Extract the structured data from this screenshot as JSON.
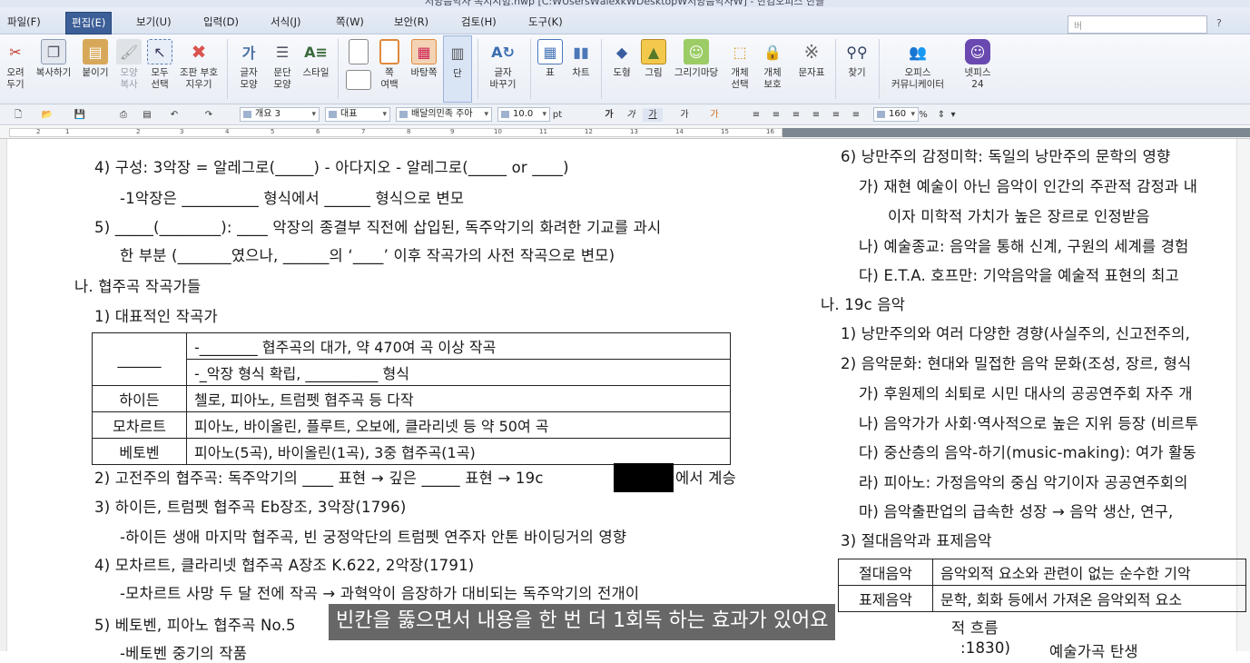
{
  "window": {
    "title": "서양음악사 복지시험.hwp [C:₩Users₩alexk₩Desktop₩서양음악사₩] - 한컴오피스 한글"
  },
  "menu": {
    "items": [
      "파일(F)",
      "편집(E)",
      "보기(U)",
      "입력(D)",
      "서식(J)",
      "쪽(W)",
      "보안(R)",
      "검토(H)",
      "도구(K)"
    ],
    "active": "편집(E)",
    "search_placeholder": "버"
  },
  "ribbon": {
    "buttons": [
      {
        "label": "오려\n두기",
        "icon": "scissors-icon",
        "color": "#c0392b"
      },
      {
        "label": "복사하기",
        "icon": "copy-icon",
        "color": "#7a8fa8"
      },
      {
        "label": "붙이기",
        "icon": "paste-icon",
        "color": "#c89a4a"
      },
      {
        "label": "모양\n복사",
        "icon": "format-painter-icon",
        "color": "#b8bec8"
      },
      {
        "label": "모두\n선택",
        "icon": "select-all-icon",
        "color": "#5b7fb8"
      },
      {
        "label": "조판 부호\n지우기",
        "icon": "clear-codes-icon",
        "color": "#d9534f"
      },
      {
        "label": "글자\n모양",
        "icon": "char-shape-icon",
        "color": "#4a6fa5"
      },
      {
        "label": "문단\n모양",
        "icon": "para-shape-icon",
        "color": "#6b7d95"
      },
      {
        "label": "스타일",
        "icon": "style-icon",
        "color": "#5a8a5a"
      },
      {
        "label": "쪽\n여백",
        "icon": "page-margin-icon",
        "color": "#9aa8bb"
      },
      {
        "label": "바탕쪽",
        "icon": "master-page-icon",
        "color": "#e08a3c"
      },
      {
        "label": "단",
        "icon": "columns-icon",
        "color": "#6b7d95"
      },
      {
        "label": "글자\n바꾸기",
        "icon": "replace-char-icon",
        "color": "#3a6fb0"
      },
      {
        "label": "표",
        "icon": "table-icon",
        "color": "#4a78b8"
      },
      {
        "label": "차트",
        "icon": "chart-icon",
        "color": "#4a78b8"
      },
      {
        "label": "도형",
        "icon": "shape-icon",
        "color": "#3a5fa0"
      },
      {
        "label": "그림",
        "icon": "picture-icon",
        "color": "#e0b040"
      },
      {
        "label": "그리기마당",
        "icon": "clipart-icon",
        "color": "#7fb84a"
      },
      {
        "label": "개체\n선택",
        "icon": "object-select-icon",
        "color": "#e0b040"
      },
      {
        "label": "개체\n보호",
        "icon": "object-lock-icon",
        "color": "#e0a030"
      },
      {
        "label": "문자표",
        "icon": "symbol-icon",
        "color": "#777"
      },
      {
        "label": "찾기",
        "icon": "binoculars-icon",
        "color": "#3a4a6a"
      },
      {
        "label": "오피스\n커뮤니케이터",
        "icon": "communicator-icon",
        "color": "#6a9ad0"
      },
      {
        "label": "넷피스\n24",
        "icon": "netffice-icon",
        "color": "#6a4ab0"
      }
    ]
  },
  "format_toolbar": {
    "style": "개요 3",
    "font_group": "대표",
    "font": "배달의민족 주아",
    "size": "10.0",
    "unit": "pt",
    "zoom": "160",
    "zoom_unit": "%"
  },
  "ruler": {
    "ticks": [
      "2",
      "1",
      "2",
      "3",
      "4",
      "5",
      "6",
      "7",
      "8",
      "9",
      "10",
      "11",
      "12",
      "13",
      "14",
      "15",
      "16"
    ]
  },
  "document": {
    "left": {
      "lines": [
        "4) 구성: 3악장 = 알레그로(_____) - 아다지오 - 알레그로(_____ or ____)",
        "-1악장은 __________ 형식에서 ______ 형식으로 변모",
        "5) _____(________): ____ 악장의 종결부 직전에 삽입된, 독주악기의 화려한 기교를 과시",
        "한 부분 (_______였으나, ______의 ‘____’ 이후 작곡가의 사전 작곡으로 변모)",
        "나. 협주곡 작곡가들",
        "1) 대표적인 작곡가"
      ],
      "table": {
        "row0_name": "______",
        "row0_line1": "-________ 협주곡의 대가, 약 470여 곡 이상 작곡",
        "row0_line2": "-_악장 형식 확립, __________ 형식",
        "rows": [
          {
            "name": "하이든",
            "desc": "첼로, 피아노, 트럼펫 협주곡 등 다작"
          },
          {
            "name": "모차르트",
            "desc": "피아노, 바이올린, 플루트, 오보에, 클라리넷 등 약 50여 곡"
          },
          {
            "name": "베토벤",
            "desc": "피아노(5곡), 바이올린(1곡), 3중 협주곡(1곡)"
          }
        ]
      },
      "lines2": [
        "2) 고전주의 협주곡: 독주악기의 ____ 표현 → 깊은 _____ 표현 → 19c",
        "에서 계승",
        "3) 하이든, 트럼펫 협주곡 Eb장조, 3악장(1796)",
        "-하이든 생애 마지막 협주곡, 빈 궁정악단의 트럼펫 연주자 안톤 바이딩거의 영향",
        "4) 모차르트, 클라리넷 협주곡 A장조 K.622, 2악장(1791)",
        "-모차르트 사망 두 달 전에 작곡 → 과혁악이 음장하가 대비되는 독주악기의 전개이",
        "5) 베토벤, 피아노 협주곡 No.5",
        "-베토벤 중기의 작품"
      ]
    },
    "right": {
      "lines": [
        "6) 낭만주의 감정미학: 독일의 낭만주의 문학의 영향",
        "가) 재현 예술이 아닌 음악이 인간의 주관적 감정과 내",
        "이자 미학적 가치가 높은 장르로 인정받음",
        "나) 예술종교: 음악을 통해 신계, 구원의 세계를 경험",
        "다) E.T.A. 호프만: 기악음악을 예술적 표현의 최고",
        "나. 19c 음악",
        "1) 낭만주의와 여러 다양한 경향(사실주의, 신고전주의,",
        "2) 음악문화: 현대와 밀접한 음악 문화(조성, 장르, 형식",
        "가) 후원제의 쇠퇴로 시민 대사의 공공연주회 자주 개",
        "나) 음악가가 사회·역사적으로 높은 지위 등장 (비르투",
        "다) 중산층의 음악-하기(music-making): 여가 활동",
        "라) 피아노: 가정음악의 중심 악기이자 공공연주회의",
        "마) 음악출판업의 급속한 성장 → 음악 생산, 연구,",
        "3) 절대음악과 표제음악"
      ],
      "table": {
        "rows": [
          {
            "name": "절대음악",
            "desc": "음악외적 요소와 관련이 없는 순수한 기악"
          },
          {
            "name": "표제음악",
            "desc": "문학, 회화 등에서 가져온 음악외적 요소"
          }
        ]
      },
      "tail": "적 흐름",
      "period": {
        "years": ":1830)",
        "desc": "예술가곡 탄생"
      }
    },
    "subtitle": "빈칸을 뚫으면서 내용을 한 번 더 1회독 하는 효과가 있어요"
  }
}
